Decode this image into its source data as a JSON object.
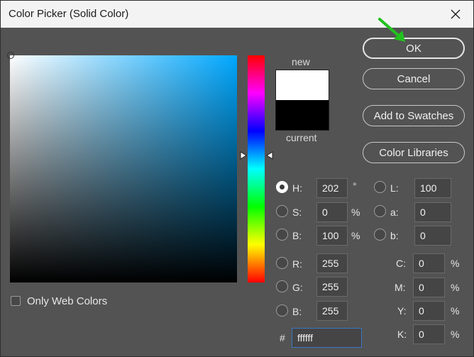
{
  "window": {
    "title": "Color Picker (Solid Color)"
  },
  "picker": {
    "hue_color": "#00a8ff",
    "new_color": "#ffffff",
    "current_color": "#000000"
  },
  "swatch": {
    "new_label": "new",
    "current_label": "current"
  },
  "buttons": {
    "ok": "OK",
    "cancel": "Cancel",
    "add_to_swatches": "Add to Swatches",
    "color_libraries": "Color Libraries"
  },
  "hsb": {
    "h": {
      "label": "H:",
      "value": "202",
      "unit": "°"
    },
    "s": {
      "label": "S:",
      "value": "0",
      "unit": "%"
    },
    "b": {
      "label": "B:",
      "value": "100",
      "unit": "%"
    }
  },
  "lab": {
    "l": {
      "label": "L:",
      "value": "100"
    },
    "a": {
      "label": "a:",
      "value": "0"
    },
    "b": {
      "label": "b:",
      "value": "0"
    }
  },
  "rgb": {
    "r": {
      "label": "R:",
      "value": "255"
    },
    "g": {
      "label": "G:",
      "value": "255"
    },
    "b": {
      "label": "B:",
      "value": "255"
    }
  },
  "cmyk": {
    "c": {
      "label": "C:",
      "value": "0",
      "unit": "%"
    },
    "m": {
      "label": "M:",
      "value": "0",
      "unit": "%"
    },
    "y": {
      "label": "Y:",
      "value": "0",
      "unit": "%"
    },
    "k": {
      "label": "K:",
      "value": "0",
      "unit": "%"
    }
  },
  "hex": {
    "label": "#",
    "value": "ffffff"
  },
  "options": {
    "only_web_colors": "Only Web Colors"
  },
  "annotation": {
    "arrow_color": "#22c11f"
  }
}
